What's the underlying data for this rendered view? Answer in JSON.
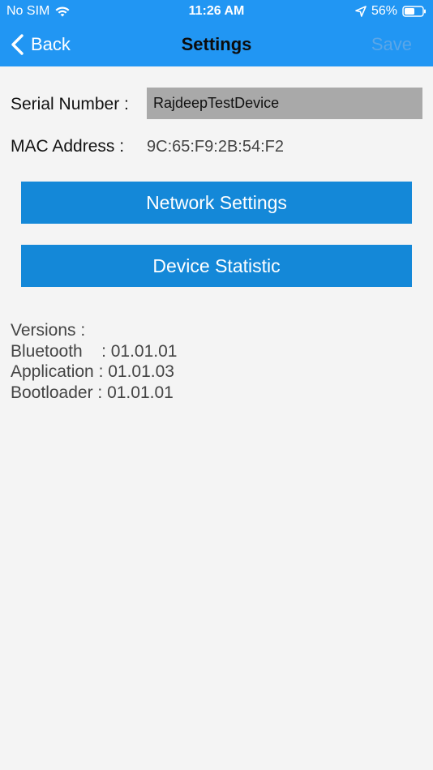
{
  "status_bar": {
    "carrier": "No SIM",
    "time": "11:26 AM",
    "battery": "56%"
  },
  "nav": {
    "back_label": "Back",
    "title": "Settings",
    "save_label": "Save"
  },
  "device": {
    "serial_label": "Serial Number :",
    "serial_value": "RajdeepTestDevice",
    "mac_label": "MAC Address :",
    "mac_value": "9C:65:F9:2B:54:F2"
  },
  "buttons": {
    "network_settings": "Network Settings",
    "device_statistic": "Device Statistic"
  },
  "versions": {
    "heading": "Versions :",
    "bluetooth": "Bluetooth    : 01.01.01",
    "application": "Application : 01.01.03",
    "bootloader": "Bootloader : 01.01.01"
  },
  "colors": {
    "header": "#2196f3",
    "button": "#1488d8",
    "background": "#f4f4f4",
    "input": "#a9a9a9"
  }
}
